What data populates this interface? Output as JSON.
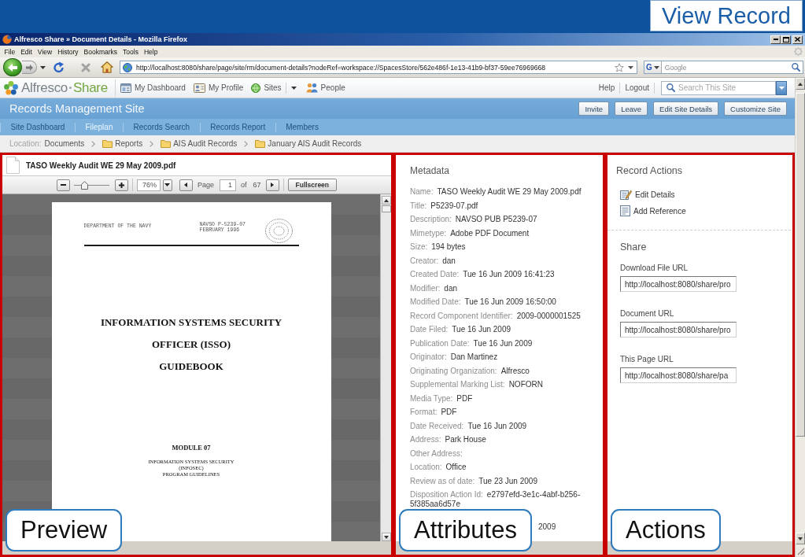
{
  "slide": {
    "title": "View Record"
  },
  "window": {
    "title": "Alfresco Share » Document Details - Mozilla Firefox"
  },
  "menu": [
    "File",
    "Edit",
    "View",
    "History",
    "Bookmarks",
    "Tools",
    "Help"
  ],
  "address_bar": {
    "url": "http://localhost:8080/share/page/site/rm/document-details?nodeRef=workspace://SpacesStore/562e486f-1e13-41b9-bf37-59ee76969668"
  },
  "web_search": {
    "engine": "G",
    "placeholder": "Google"
  },
  "app_header": {
    "logo": {
      "name": "Alfresco",
      "product": "Share"
    },
    "links": [
      {
        "label": "My Dashboard",
        "kind": "dashboard",
        "dropdown": false
      },
      {
        "label": "My Profile",
        "kind": "profile",
        "dropdown": false
      },
      {
        "label": "Sites",
        "kind": "sites",
        "dropdown": true
      },
      {
        "label": "People",
        "kind": "people",
        "dropdown": false
      }
    ],
    "user_links": [
      "Help",
      "Logout"
    ],
    "search": {
      "placeholder": "Search This Site"
    }
  },
  "site": {
    "title": "Records Management Site",
    "buttons": [
      "Invite",
      "Leave",
      "Edit Site Details",
      "Customize Site"
    ]
  },
  "site_nav": [
    {
      "label": "Site Dashboard",
      "selected": false
    },
    {
      "label": "Fileplan",
      "selected": true
    },
    {
      "label": "Records Search",
      "selected": false
    },
    {
      "label": "Records Report",
      "selected": false
    },
    {
      "label": "Members",
      "selected": false
    }
  ],
  "location": {
    "label": "Location:",
    "path": [
      {
        "label": "Documents",
        "kind": "root"
      },
      {
        "label": "Reports",
        "kind": "folder"
      },
      {
        "label": "AIS Audit Records",
        "kind": "folder"
      },
      {
        "label": "January AIS Audit Records",
        "kind": "folder"
      }
    ]
  },
  "preview": {
    "file_name": "TASO Weekly Audit WE 29 May 2009.pdf",
    "toolbar": {
      "zoom_slider": {
        "level": 0.25
      },
      "zoom": "76%",
      "page_label": "Page",
      "page": "1",
      "of_label": "of",
      "page_count": "67",
      "fullscreen": "Fullscreen"
    },
    "document": {
      "header_left": "DEPARTMENT OF THE NAVY",
      "header_right": [
        "NAVSO P-5239-07",
        "FEBRUARY 1996"
      ],
      "title_lines": [
        "INFORMATION SYSTEMS SECURITY",
        "OFFICER (ISSO)",
        "GUIDEBOOK"
      ],
      "module": "MODULE 07",
      "subtitle_lines": [
        "INFORMATION SYSTEMS SECURITY",
        "(INFOSEC)",
        "PROGRAM GUIDELINES"
      ]
    }
  },
  "metadata": {
    "title": "Metadata",
    "fields": [
      {
        "label": "Name:",
        "value": "TASO Weekly Audit WE 29 May 2009.pdf"
      },
      {
        "label": "Title:",
        "value": "P5239-07.pdf"
      },
      {
        "label": "Description:",
        "value": "NAVSO PUB P5239-07"
      },
      {
        "label": "Mimetype:",
        "value": "Adobe PDF Document"
      },
      {
        "label": "Size:",
        "value": "194 bytes"
      },
      {
        "label": "Creator:",
        "value": "dan"
      },
      {
        "label": "Created Date:",
        "value": "Tue 16 Jun 2009 16:41:23"
      },
      {
        "label": "Modifier:",
        "value": "dan"
      },
      {
        "label": "Modified Date:",
        "value": "Tue 16 Jun 2009 16:50:00"
      },
      {
        "label": "Record Component Identifier:",
        "value": "2009-0000001525"
      },
      {
        "label": "Date Filed:",
        "value": "Tue 16 Jun 2009"
      },
      {
        "label": "Publication Date:",
        "value": "Tue 16 Jun 2009"
      },
      {
        "label": "Originator:",
        "value": "Dan Martinez"
      },
      {
        "label": "Originating Organization:",
        "value": "Alfresco"
      },
      {
        "label": "Supplemental Marking List:",
        "value": "NOFORN"
      },
      {
        "label": "Media Type:",
        "value": "PDF"
      },
      {
        "label": "Format:",
        "value": "PDF"
      },
      {
        "label": "Date Received:",
        "value": "Tue 16 Jun 2009"
      },
      {
        "label": "Address:",
        "value": "Park House"
      },
      {
        "label": "Other Address:"
      },
      {
        "label": "Location:",
        "value": "Office"
      },
      {
        "label": "Review as of date:",
        "value": "Tue 23 Jun 2009"
      },
      {
        "label": "Disposition Action Id:",
        "value": "e2797efd-3e1c-4abf-b256-5f385aa6d57e"
      },
      {
        "value": "2009"
      }
    ]
  },
  "record_actions": {
    "title": "Record Actions",
    "actions": [
      {
        "label": "Edit Details",
        "kind": "edit"
      },
      {
        "label": "Add Reference",
        "kind": "reference"
      }
    ]
  },
  "share": {
    "title": "Share",
    "fields": [
      {
        "label": "Download File URL",
        "value": "http://localhost:8080/share/pro"
      },
      {
        "label": "Document URL",
        "value": "http://localhost:8080/share/pro"
      },
      {
        "label": "This Page URL",
        "value": "http://localhost:8080/share/pa"
      }
    ]
  },
  "callouts": [
    "Preview",
    "Attributes",
    "Actions"
  ]
}
